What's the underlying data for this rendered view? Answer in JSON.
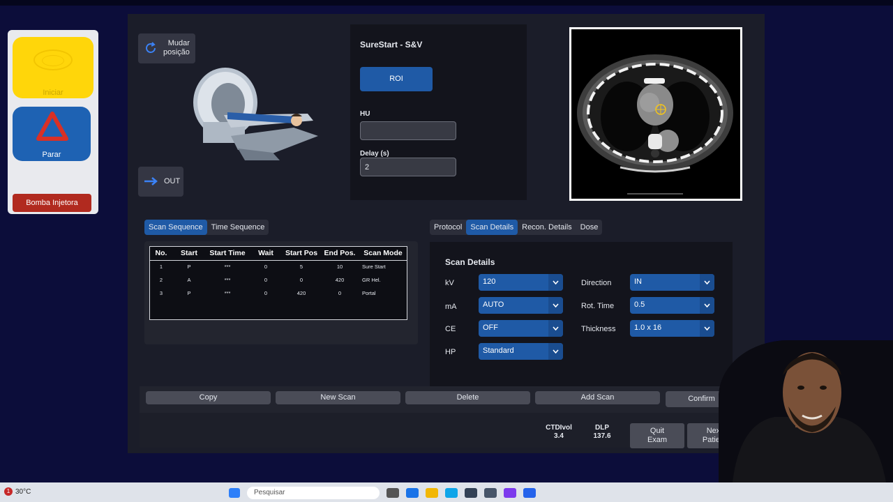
{
  "control_panel": {
    "start_label": "Iniciar",
    "stop_label": "Parar",
    "pump_label": "Bomba Injetora"
  },
  "scanner": {
    "change_position_label": "Mudar\nposição",
    "out_label": "OUT"
  },
  "roi_panel": {
    "title": "SureStart - S&V",
    "roi_button": "ROI",
    "hu_label": "HU",
    "hu_value": "",
    "delay_label": "Delay (s)",
    "delay_value": "2"
  },
  "sequence_tabs": [
    {
      "label": "Scan Sequence",
      "active": true
    },
    {
      "label": "Time Sequence",
      "active": false
    }
  ],
  "sequence_table": {
    "headers": [
      "No.",
      "Start",
      "Start Time",
      "Wait",
      "Start Pos",
      "End Pos.",
      "Scan Mode"
    ],
    "rows": [
      [
        "1",
        "P",
        "***",
        "0",
        "5",
        "10",
        "Sure Start"
      ],
      [
        "2",
        "A",
        "***",
        "0",
        "0",
        "420",
        "GR Hel."
      ],
      [
        "3",
        "P",
        "***",
        "0",
        "420",
        "0",
        "Portal"
      ]
    ]
  },
  "detail_tabs": [
    {
      "label": "Protocol",
      "active": false
    },
    {
      "label": "Scan Details",
      "active": true
    },
    {
      "label": "Recon. Details",
      "active": false
    },
    {
      "label": "Dose",
      "active": false
    }
  ],
  "scan_details": {
    "title": "Scan Details",
    "kv_label": "kV",
    "kv_value": "120",
    "ma_label": "mA",
    "ma_value": "AUTO",
    "ce_label": "CE",
    "ce_value": "OFF",
    "hp_label": "HP",
    "hp_value": "Standard",
    "direction_label": "Direction",
    "direction_value": "IN",
    "rot_label": "Rot. Time",
    "rot_value": "0.5",
    "thickness_label": "Thickness",
    "thickness_value": "1.0 x 16"
  },
  "actions": {
    "copy": "Copy",
    "new_scan": "New Scan",
    "delete": "Delete",
    "add_scan": "Add Scan",
    "confirm": "Confirm"
  },
  "footer": {
    "ctdi_label": "CTDIvol",
    "ctdi_value": "3.4",
    "dlp_label": "DLP",
    "dlp_value": "137.6",
    "quit_label": "Quit\nExam",
    "next_label": "Next\nPatient"
  },
  "taskbar": {
    "notification_count": "1",
    "temperature": "30°C",
    "search_placeholder": "Pesquisar"
  },
  "colors": {
    "accent": "#1f5aa6",
    "start_button": "#ffd60a",
    "stop_button": "#1e62b3",
    "pump_button": "#b12a1f",
    "background": "#0c0d3a"
  }
}
